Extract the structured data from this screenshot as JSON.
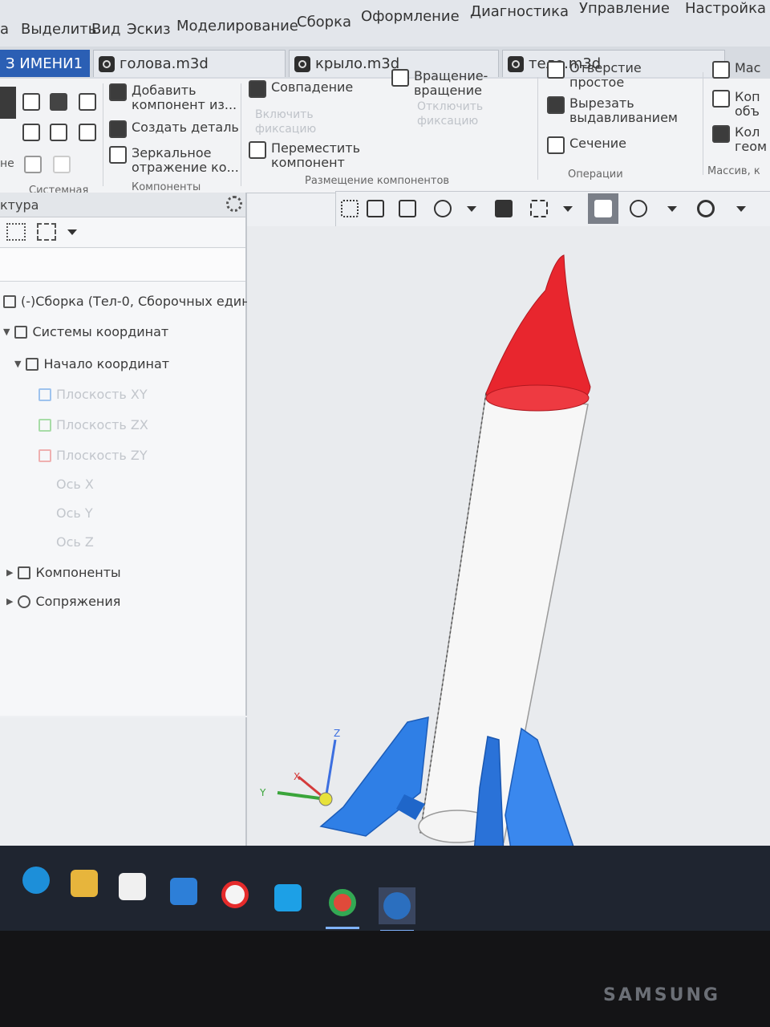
{
  "menu": [
    "а",
    "Выделить",
    "Вид",
    "Эскиз",
    "Моделирование",
    "Сборка",
    "Оформление",
    "Диагностика",
    "Управление",
    "Настройка"
  ],
  "tabs": [
    {
      "label": "З ИМЕНИ1",
      "close": "×"
    },
    {
      "label": "голова.m3d"
    },
    {
      "label": "крыло.m3d"
    },
    {
      "label": "тело.m3d"
    }
  ],
  "ribbon": {
    "system_label": "Системная",
    "components_label": "Компоненты",
    "placement_label": "Размещение компонентов",
    "operations_label": "Операции",
    "array_label": "Массив, к",
    "side_text": "не",
    "add_component": [
      "Добавить",
      "компонент из..."
    ],
    "create_part": "Создать деталь",
    "mirror": [
      "Зеркальное",
      "отражение ко..."
    ],
    "coincidence": "Совпадение",
    "enable_fix": [
      "Включить",
      "фиксацию"
    ],
    "move_component": [
      "Переместить",
      "компонент"
    ],
    "rotation": [
      "Вращение-",
      "вращение"
    ],
    "disable_fix": [
      "Отключить",
      "фиксацию"
    ],
    "hole": [
      "Отверстие",
      "простое"
    ],
    "extrude_cut": [
      "Вырезать",
      "выдавливанием"
    ],
    "section": "Сечение",
    "mac": "Мас",
    "copy_obj": [
      "Коп",
      "объ"
    ],
    "coll_geom": [
      "Кол",
      "геом"
    ]
  },
  "tree": {
    "header": "ктура",
    "root": "(-)Сборка (Тел-0, Сборочных един",
    "coord_systems": "Системы координат",
    "origin": "Начало координат",
    "plane_xy": "Плоскость XY",
    "plane_zx": "Плоскость ZX",
    "plane_zy": "Плоскость ZY",
    "axis_x": "Ось X",
    "axis_y": "Ось Y",
    "axis_z": "Ось Z",
    "components": "Компоненты",
    "mates": "Сопряжения"
  },
  "triad": {
    "z": "Z",
    "x": "X",
    "y": "Y"
  },
  "colors": {
    "nose": "#e8262e",
    "fins": "#2f7fe6",
    "body": "#f7f7f7"
  },
  "brand": "SAMSUNG"
}
